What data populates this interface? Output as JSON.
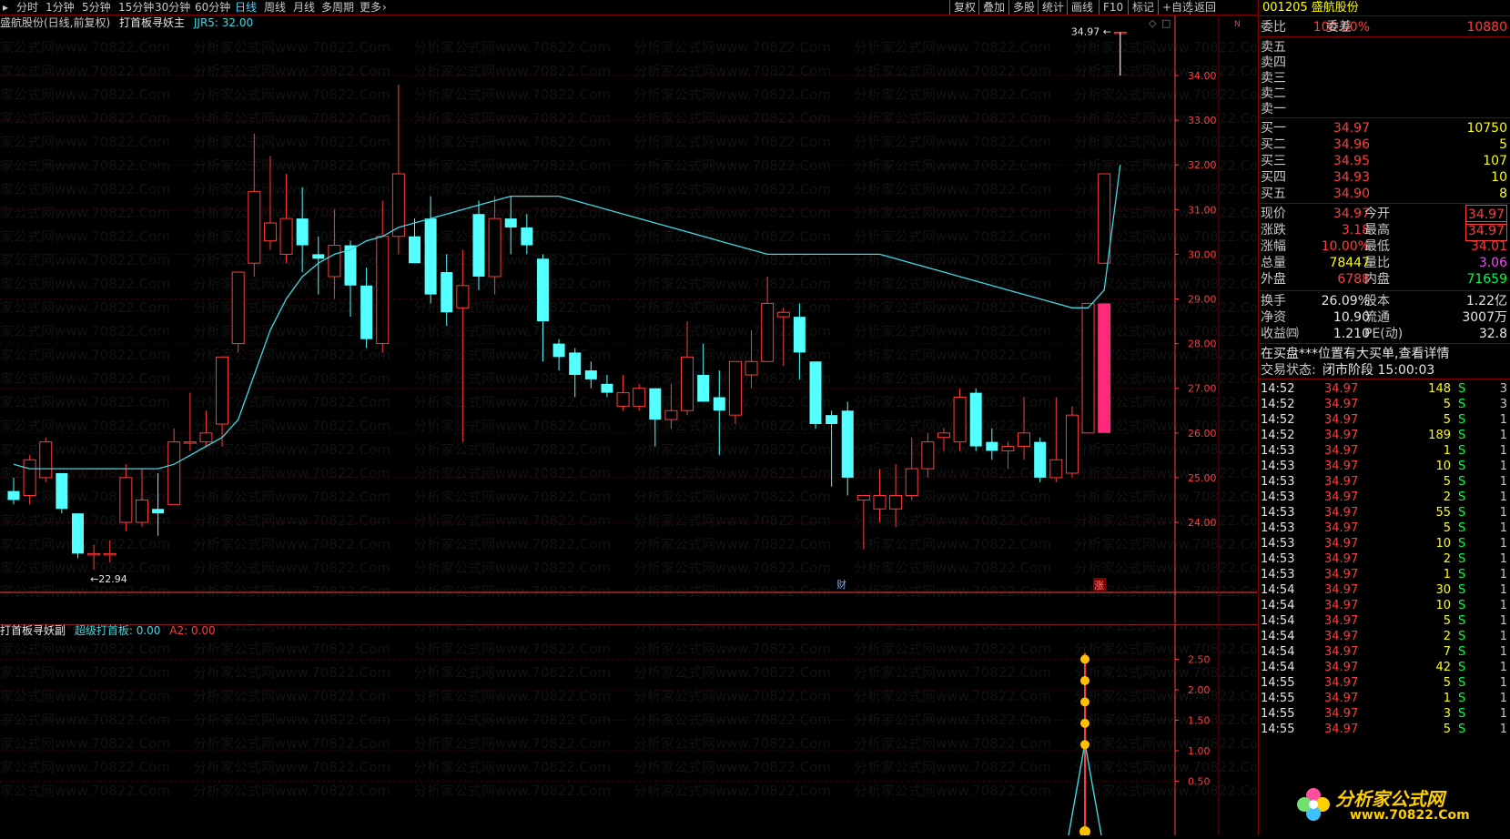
{
  "toolbar": {
    "timeframes": [
      "分时",
      "1分钟",
      "5分钟",
      "15分钟",
      "30分钟",
      "60分钟",
      "日线",
      "周线",
      "月线",
      "多周期",
      "更多"
    ],
    "active_timeframe": "日线",
    "buttons": [
      "复权",
      "叠加",
      "多股",
      "统计",
      "画线",
      "F10",
      "标记",
      "+自选",
      "返回"
    ]
  },
  "main_legend": {
    "stock": "盛航股份(日线,前复权)",
    "indicator": "打首板寻妖主",
    "value": "JJR5: 32.00"
  },
  "sub_legend": {
    "indicator": "打首板寻妖副",
    "line1": "超级打首板: 0.00",
    "line2": "A2: 0.00"
  },
  "main_axis": [
    "34.00",
    "33.00",
    "32.00",
    "31.00",
    "30.00",
    "29.00",
    "28.00",
    "27.00",
    "26.00",
    "25.00",
    "24.00"
  ],
  "sub_axis": [
    "2.50",
    "2.00",
    "1.50",
    "1.00",
    "0.50"
  ],
  "annotations": {
    "high": "34.97",
    "low": "22.94",
    "cai": "财",
    "zhang": "涨"
  },
  "watermark": "分析家公式网www.70822.Com",
  "logo": {
    "text": "分析家公式网",
    "url": "www.70822.Com"
  },
  "colors": {
    "up": "#ff3b3b",
    "down": "#54ffff",
    "ma": "#3fd8e0",
    "limit_up": "#ff2a7a",
    "grid": "#800000"
  },
  "chart_data": {
    "type": "candlestick",
    "title": "盛航股份(日线,前复权)",
    "ylim": [
      23.0,
      35.0
    ],
    "candles": [
      {
        "o": 24.7,
        "h": 25.0,
        "l": 24.4,
        "c": 24.5
      },
      {
        "o": 24.6,
        "h": 25.5,
        "l": 24.4,
        "c": 25.4
      },
      {
        "o": 25.0,
        "h": 25.9,
        "l": 24.9,
        "c": 25.8
      },
      {
        "o": 25.1,
        "h": 25.1,
        "l": 24.2,
        "c": 24.3
      },
      {
        "o": 24.2,
        "h": 24.2,
        "l": 23.2,
        "c": 23.3
      },
      {
        "o": 23.3,
        "h": 23.5,
        "l": 22.94,
        "c": 23.3
      },
      {
        "o": 23.3,
        "h": 23.6,
        "l": 23.1,
        "c": 23.3
      },
      {
        "o": 24.0,
        "h": 25.3,
        "l": 23.8,
        "c": 25.0
      },
      {
        "o": 24.0,
        "h": 25.2,
        "l": 23.9,
        "c": 24.5
      },
      {
        "o": 24.3,
        "h": 25.1,
        "l": 23.7,
        "c": 24.2
      },
      {
        "o": 24.4,
        "h": 26.1,
        "l": 24.4,
        "c": 25.8
      },
      {
        "o": 25.8,
        "h": 26.9,
        "l": 25.6,
        "c": 25.8
      },
      {
        "o": 25.8,
        "h": 26.5,
        "l": 25.7,
        "c": 26.0
      },
      {
        "o": 26.2,
        "h": 27.2,
        "l": 25.7,
        "c": 27.7
      },
      {
        "o": 28.0,
        "h": 29.3,
        "l": 27.8,
        "c": 29.6
      },
      {
        "o": 29.8,
        "h": 32.7,
        "l": 29.5,
        "c": 31.4
      },
      {
        "o": 30.3,
        "h": 32.2,
        "l": 30.1,
        "c": 30.7
      },
      {
        "o": 30.0,
        "h": 31.8,
        "l": 29.8,
        "c": 30.8
      },
      {
        "o": 30.8,
        "h": 31.5,
        "l": 29.6,
        "c": 30.2
      },
      {
        "o": 30.0,
        "h": 30.4,
        "l": 29.1,
        "c": 29.9
      },
      {
        "o": 29.5,
        "h": 31.0,
        "l": 29.0,
        "c": 30.2
      },
      {
        "o": 30.2,
        "h": 30.3,
        "l": 28.6,
        "c": 29.3
      },
      {
        "o": 29.3,
        "h": 29.7,
        "l": 27.9,
        "c": 28.1
      },
      {
        "o": 28.0,
        "h": 31.2,
        "l": 27.8,
        "c": 30.4
      },
      {
        "o": 30.4,
        "h": 33.8,
        "l": 30.0,
        "c": 31.8
      },
      {
        "o": 30.4,
        "h": 30.8,
        "l": 29.8,
        "c": 29.8
      },
      {
        "o": 30.8,
        "h": 31.3,
        "l": 28.9,
        "c": 29.1
      },
      {
        "o": 29.6,
        "h": 30.0,
        "l": 28.4,
        "c": 28.7
      },
      {
        "o": 28.8,
        "h": 30.1,
        "l": 25.8,
        "c": 29.3
      },
      {
        "o": 30.9,
        "h": 31.2,
        "l": 29.2,
        "c": 29.5
      },
      {
        "o": 29.5,
        "h": 31.3,
        "l": 29.1,
        "c": 30.8
      },
      {
        "o": 30.8,
        "h": 31.3,
        "l": 30.0,
        "c": 30.6
      },
      {
        "o": 30.6,
        "h": 30.9,
        "l": 30.0,
        "c": 30.2
      },
      {
        "o": 29.9,
        "h": 30.0,
        "l": 27.6,
        "c": 28.5
      },
      {
        "o": 28.0,
        "h": 28.1,
        "l": 27.4,
        "c": 27.7
      },
      {
        "o": 27.8,
        "h": 27.9,
        "l": 26.8,
        "c": 27.3
      },
      {
        "o": 27.4,
        "h": 27.6,
        "l": 27.0,
        "c": 27.2
      },
      {
        "o": 27.1,
        "h": 27.3,
        "l": 26.8,
        "c": 26.9
      },
      {
        "o": 26.6,
        "h": 27.3,
        "l": 26.5,
        "c": 26.9
      },
      {
        "o": 26.6,
        "h": 27.1,
        "l": 26.5,
        "c": 27.0
      },
      {
        "o": 27.0,
        "h": 27.0,
        "l": 25.7,
        "c": 26.3
      },
      {
        "o": 26.3,
        "h": 27.1,
        "l": 26.1,
        "c": 26.5
      },
      {
        "o": 26.5,
        "h": 28.5,
        "l": 26.4,
        "c": 27.7
      },
      {
        "o": 27.3,
        "h": 28.0,
        "l": 26.7,
        "c": 26.7
      },
      {
        "o": 26.8,
        "h": 27.4,
        "l": 25.5,
        "c": 26.5
      },
      {
        "o": 26.4,
        "h": 27.6,
        "l": 26.2,
        "c": 27.6
      },
      {
        "o": 27.3,
        "h": 28.3,
        "l": 27.0,
        "c": 27.6
      },
      {
        "o": 27.6,
        "h": 29.5,
        "l": 27.6,
        "c": 28.9
      },
      {
        "o": 28.6,
        "h": 28.8,
        "l": 27.5,
        "c": 28.7
      },
      {
        "o": 28.6,
        "h": 28.9,
        "l": 27.2,
        "c": 27.8
      },
      {
        "o": 27.6,
        "h": 27.6,
        "l": 26.1,
        "c": 26.2
      },
      {
        "o": 26.4,
        "h": 26.5,
        "l": 24.8,
        "c": 26.2
      },
      {
        "o": 26.5,
        "h": 26.7,
        "l": 24.6,
        "c": 25.0
      },
      {
        "o": 24.5,
        "h": 24.6,
        "l": 23.4,
        "c": 24.6
      },
      {
        "o": 24.3,
        "h": 25.2,
        "l": 24.0,
        "c": 24.6
      },
      {
        "o": 24.3,
        "h": 25.3,
        "l": 23.9,
        "c": 24.6
      },
      {
        "o": 24.6,
        "h": 25.9,
        "l": 24.5,
        "c": 25.2
      },
      {
        "o": 25.2,
        "h": 26.0,
        "l": 25.0,
        "c": 25.8
      },
      {
        "o": 25.9,
        "h": 26.1,
        "l": 25.6,
        "c": 26.0
      },
      {
        "o": 25.8,
        "h": 27.0,
        "l": 25.6,
        "c": 26.8
      },
      {
        "o": 26.9,
        "h": 27.0,
        "l": 25.6,
        "c": 25.7
      },
      {
        "o": 25.8,
        "h": 26.1,
        "l": 25.4,
        "c": 25.6
      },
      {
        "o": 25.6,
        "h": 25.8,
        "l": 25.2,
        "c": 25.7
      },
      {
        "o": 25.7,
        "h": 26.8,
        "l": 25.4,
        "c": 26.0
      },
      {
        "o": 25.8,
        "h": 25.9,
        "l": 24.9,
        "c": 25.0
      },
      {
        "o": 25.0,
        "h": 26.8,
        "l": 24.9,
        "c": 25.4
      },
      {
        "o": 25.1,
        "h": 26.6,
        "l": 25.0,
        "c": 26.4
      },
      {
        "o": 26.0,
        "h": 28.9,
        "l": 26.0,
        "c": 28.9
      },
      {
        "o": 29.8,
        "h": 31.8,
        "l": 29.8,
        "c": 31.8
      },
      {
        "o": 34.97,
        "h": 34.97,
        "l": 34.0,
        "c": 34.97
      }
    ],
    "ma_line": [
      25.3,
      25.2,
      25.2,
      25.2,
      25.2,
      25.2,
      25.2,
      25.2,
      25.2,
      25.2,
      25.3,
      25.5,
      25.7,
      25.9,
      26.3,
      27.3,
      28.3,
      29.0,
      29.5,
      29.8,
      30.0,
      30.1,
      30.3,
      30.4,
      30.6,
      30.7,
      30.8,
      30.9,
      31.0,
      31.1,
      31.2,
      31.3,
      31.3,
      31.3,
      31.3,
      31.2,
      31.1,
      31.0,
      30.9,
      30.8,
      30.7,
      30.6,
      30.5,
      30.4,
      30.3,
      30.2,
      30.1,
      30.0,
      30.0,
      30.0,
      30.0,
      30.0,
      30.0,
      30.0,
      30.0,
      29.9,
      29.8,
      29.7,
      29.6,
      29.5,
      29.4,
      29.3,
      29.2,
      29.1,
      29.0,
      28.9,
      28.8,
      28.8,
      29.2,
      32.0
    ],
    "limit_up_bar": {
      "low": 26.0,
      "high": 28.9
    },
    "sub_series": {
      "name": "超级打首板",
      "peak": 2.5
    },
    "sub_ylim": [
      0,
      2.8
    ]
  },
  "quote": {
    "code": "001205",
    "name": "盛航股份",
    "weibi_label": "委比",
    "weibi": "100.00%",
    "weicha_label": "委差",
    "weicha": "10880",
    "sells": [
      "卖五",
      "卖四",
      "卖三",
      "卖二",
      "卖一"
    ],
    "buys": [
      {
        "label": "买一",
        "price": "34.97",
        "vol": "10750"
      },
      {
        "label": "买二",
        "price": "34.96",
        "vol": "5"
      },
      {
        "label": "买三",
        "price": "34.95",
        "vol": "107"
      },
      {
        "label": "买四",
        "price": "34.93",
        "vol": "10"
      },
      {
        "label": "买五",
        "price": "34.90",
        "vol": "8"
      }
    ],
    "stats": [
      {
        "l1": "现价",
        "v1": "34.97",
        "c1": "red",
        "l2": "今开",
        "v2": "34.97",
        "c2": "red",
        "box": true
      },
      {
        "l1": "涨跌",
        "v1": "3.18",
        "c1": "red",
        "l2": "最高",
        "v2": "34.97",
        "c2": "red",
        "box": true
      },
      {
        "l1": "涨幅",
        "v1": "10.00%",
        "c1": "red",
        "l2": "最低",
        "v2": "34.01",
        "c2": "red"
      },
      {
        "l1": "总量",
        "v1": "78447",
        "c1": "yel",
        "l2": "量比",
        "v2": "3.06",
        "c2": "mag"
      },
      {
        "l1": "外盘",
        "v1": "6788",
        "c1": "red",
        "l2": "内盘",
        "v2": "71659",
        "c2": "grn"
      }
    ],
    "fund": [
      {
        "l1": "换手",
        "v1": "26.09%",
        "l2": "股本",
        "v2": "1.22亿"
      },
      {
        "l1": "净资",
        "v1": "10.90",
        "l2": "流通",
        "v2": "3007万"
      },
      {
        "l1": "收益㈣",
        "v1": "1.210",
        "l2": "PE(动)",
        "v2": "32.8"
      }
    ],
    "notice": "在买盘***位置有大买单,查看详情",
    "status_label": "交易状态:",
    "status": "闭市阶段 15:00:03"
  },
  "ticks": [
    {
      "t": "14:52",
      "p": "34.97",
      "q": "148",
      "s": "S",
      "n": "3"
    },
    {
      "t": "14:52",
      "p": "34.97",
      "q": "5",
      "s": "S",
      "n": "3"
    },
    {
      "t": "14:52",
      "p": "34.97",
      "q": "5",
      "s": "S",
      "n": "1"
    },
    {
      "t": "14:52",
      "p": "34.97",
      "q": "189",
      "s": "S",
      "n": "1"
    },
    {
      "t": "14:53",
      "p": "34.97",
      "q": "1",
      "s": "S",
      "n": "1"
    },
    {
      "t": "14:53",
      "p": "34.97",
      "q": "10",
      "s": "S",
      "n": "1"
    },
    {
      "t": "14:53",
      "p": "34.97",
      "q": "5",
      "s": "S",
      "n": "1"
    },
    {
      "t": "14:53",
      "p": "34.97",
      "q": "2",
      "s": "S",
      "n": "1"
    },
    {
      "t": "14:53",
      "p": "34.97",
      "q": "55",
      "s": "S",
      "n": "1"
    },
    {
      "t": "14:53",
      "p": "34.97",
      "q": "5",
      "s": "S",
      "n": "1"
    },
    {
      "t": "14:53",
      "p": "34.97",
      "q": "10",
      "s": "S",
      "n": "1"
    },
    {
      "t": "14:53",
      "p": "34.97",
      "q": "2",
      "s": "S",
      "n": "1"
    },
    {
      "t": "14:53",
      "p": "34.97",
      "q": "1",
      "s": "S",
      "n": "1"
    },
    {
      "t": "14:54",
      "p": "34.97",
      "q": "30",
      "s": "S",
      "n": "1"
    },
    {
      "t": "14:54",
      "p": "34.97",
      "q": "10",
      "s": "S",
      "n": "1"
    },
    {
      "t": "14:54",
      "p": "34.97",
      "q": "5",
      "s": "S",
      "n": "1"
    },
    {
      "t": "14:54",
      "p": "34.97",
      "q": "2",
      "s": "S",
      "n": "1"
    },
    {
      "t": "14:54",
      "p": "34.97",
      "q": "7",
      "s": "S",
      "n": "1"
    },
    {
      "t": "14:54",
      "p": "34.97",
      "q": "42",
      "s": "S",
      "n": "1"
    },
    {
      "t": "14:55",
      "p": "34.97",
      "q": "5",
      "s": "S",
      "n": "1"
    },
    {
      "t": "14:55",
      "p": "34.97",
      "q": "1",
      "s": "S",
      "n": "1"
    },
    {
      "t": "14:55",
      "p": "34.97",
      "q": "3",
      "s": "S",
      "n": "1"
    },
    {
      "t": "14:55",
      "p": "34.97",
      "q": "5",
      "s": "S",
      "n": "1"
    }
  ]
}
